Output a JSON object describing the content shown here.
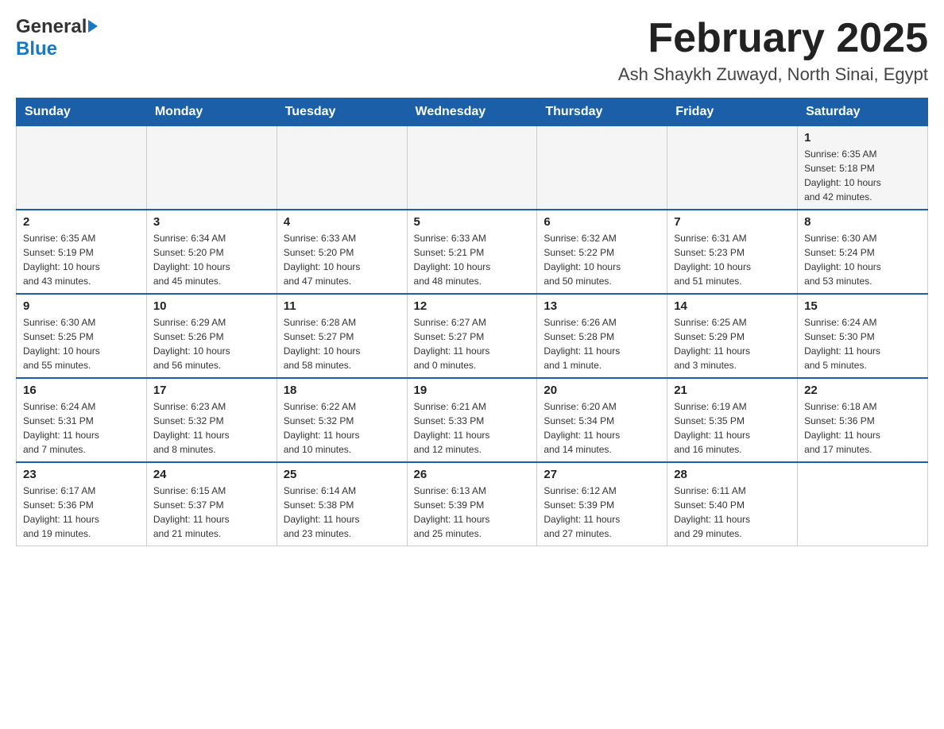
{
  "header": {
    "logo_general": "General",
    "logo_blue": "Blue",
    "month_title": "February 2025",
    "location": "Ash Shaykh Zuwayd, North Sinai, Egypt"
  },
  "weekdays": [
    "Sunday",
    "Monday",
    "Tuesday",
    "Wednesday",
    "Thursday",
    "Friday",
    "Saturday"
  ],
  "weeks": [
    [
      {
        "day": "",
        "info": ""
      },
      {
        "day": "",
        "info": ""
      },
      {
        "day": "",
        "info": ""
      },
      {
        "day": "",
        "info": ""
      },
      {
        "day": "",
        "info": ""
      },
      {
        "day": "",
        "info": ""
      },
      {
        "day": "1",
        "info": "Sunrise: 6:35 AM\nSunset: 5:18 PM\nDaylight: 10 hours\nand 42 minutes."
      }
    ],
    [
      {
        "day": "2",
        "info": "Sunrise: 6:35 AM\nSunset: 5:19 PM\nDaylight: 10 hours\nand 43 minutes."
      },
      {
        "day": "3",
        "info": "Sunrise: 6:34 AM\nSunset: 5:20 PM\nDaylight: 10 hours\nand 45 minutes."
      },
      {
        "day": "4",
        "info": "Sunrise: 6:33 AM\nSunset: 5:20 PM\nDaylight: 10 hours\nand 47 minutes."
      },
      {
        "day": "5",
        "info": "Sunrise: 6:33 AM\nSunset: 5:21 PM\nDaylight: 10 hours\nand 48 minutes."
      },
      {
        "day": "6",
        "info": "Sunrise: 6:32 AM\nSunset: 5:22 PM\nDaylight: 10 hours\nand 50 minutes."
      },
      {
        "day": "7",
        "info": "Sunrise: 6:31 AM\nSunset: 5:23 PM\nDaylight: 10 hours\nand 51 minutes."
      },
      {
        "day": "8",
        "info": "Sunrise: 6:30 AM\nSunset: 5:24 PM\nDaylight: 10 hours\nand 53 minutes."
      }
    ],
    [
      {
        "day": "9",
        "info": "Sunrise: 6:30 AM\nSunset: 5:25 PM\nDaylight: 10 hours\nand 55 minutes."
      },
      {
        "day": "10",
        "info": "Sunrise: 6:29 AM\nSunset: 5:26 PM\nDaylight: 10 hours\nand 56 minutes."
      },
      {
        "day": "11",
        "info": "Sunrise: 6:28 AM\nSunset: 5:27 PM\nDaylight: 10 hours\nand 58 minutes."
      },
      {
        "day": "12",
        "info": "Sunrise: 6:27 AM\nSunset: 5:27 PM\nDaylight: 11 hours\nand 0 minutes."
      },
      {
        "day": "13",
        "info": "Sunrise: 6:26 AM\nSunset: 5:28 PM\nDaylight: 11 hours\nand 1 minute."
      },
      {
        "day": "14",
        "info": "Sunrise: 6:25 AM\nSunset: 5:29 PM\nDaylight: 11 hours\nand 3 minutes."
      },
      {
        "day": "15",
        "info": "Sunrise: 6:24 AM\nSunset: 5:30 PM\nDaylight: 11 hours\nand 5 minutes."
      }
    ],
    [
      {
        "day": "16",
        "info": "Sunrise: 6:24 AM\nSunset: 5:31 PM\nDaylight: 11 hours\nand 7 minutes."
      },
      {
        "day": "17",
        "info": "Sunrise: 6:23 AM\nSunset: 5:32 PM\nDaylight: 11 hours\nand 8 minutes."
      },
      {
        "day": "18",
        "info": "Sunrise: 6:22 AM\nSunset: 5:32 PM\nDaylight: 11 hours\nand 10 minutes."
      },
      {
        "day": "19",
        "info": "Sunrise: 6:21 AM\nSunset: 5:33 PM\nDaylight: 11 hours\nand 12 minutes."
      },
      {
        "day": "20",
        "info": "Sunrise: 6:20 AM\nSunset: 5:34 PM\nDaylight: 11 hours\nand 14 minutes."
      },
      {
        "day": "21",
        "info": "Sunrise: 6:19 AM\nSunset: 5:35 PM\nDaylight: 11 hours\nand 16 minutes."
      },
      {
        "day": "22",
        "info": "Sunrise: 6:18 AM\nSunset: 5:36 PM\nDaylight: 11 hours\nand 17 minutes."
      }
    ],
    [
      {
        "day": "23",
        "info": "Sunrise: 6:17 AM\nSunset: 5:36 PM\nDaylight: 11 hours\nand 19 minutes."
      },
      {
        "day": "24",
        "info": "Sunrise: 6:15 AM\nSunset: 5:37 PM\nDaylight: 11 hours\nand 21 minutes."
      },
      {
        "day": "25",
        "info": "Sunrise: 6:14 AM\nSunset: 5:38 PM\nDaylight: 11 hours\nand 23 minutes."
      },
      {
        "day": "26",
        "info": "Sunrise: 6:13 AM\nSunset: 5:39 PM\nDaylight: 11 hours\nand 25 minutes."
      },
      {
        "day": "27",
        "info": "Sunrise: 6:12 AM\nSunset: 5:39 PM\nDaylight: 11 hours\nand 27 minutes."
      },
      {
        "day": "28",
        "info": "Sunrise: 6:11 AM\nSunset: 5:40 PM\nDaylight: 11 hours\nand 29 minutes."
      },
      {
        "day": "",
        "info": ""
      }
    ]
  ]
}
